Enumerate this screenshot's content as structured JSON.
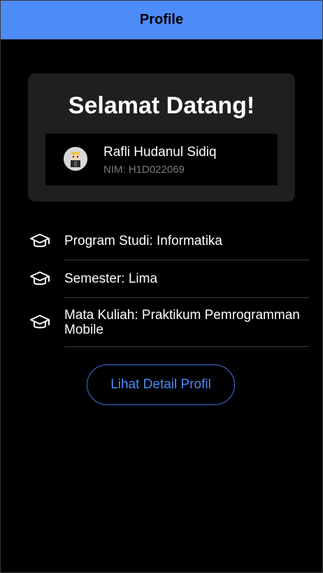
{
  "appbar": {
    "title": "Profile"
  },
  "card": {
    "welcome": "Selamat Datang!",
    "user": {
      "name": "Rafli Hudanul Sidiq",
      "nim": "NIM: H1D022069",
      "avatar_icon": "avatar-icon"
    }
  },
  "info": {
    "items": [
      {
        "icon": "graduation-cap-icon",
        "label": "Program Studi: Informatika"
      },
      {
        "icon": "graduation-cap-icon",
        "label": "Semester: Lima"
      },
      {
        "icon": "graduation-cap-icon",
        "label": "Mata Kuliah: Praktikum Pemrogramman Mobile"
      }
    ]
  },
  "actions": {
    "detail_label": "Lihat Detail Profil"
  },
  "colors": {
    "appbar": "#4d8bf7",
    "background": "#000000",
    "card": "#1f1f1f",
    "accent": "#4d8bf7",
    "muted_text": "#7a7a7a"
  }
}
